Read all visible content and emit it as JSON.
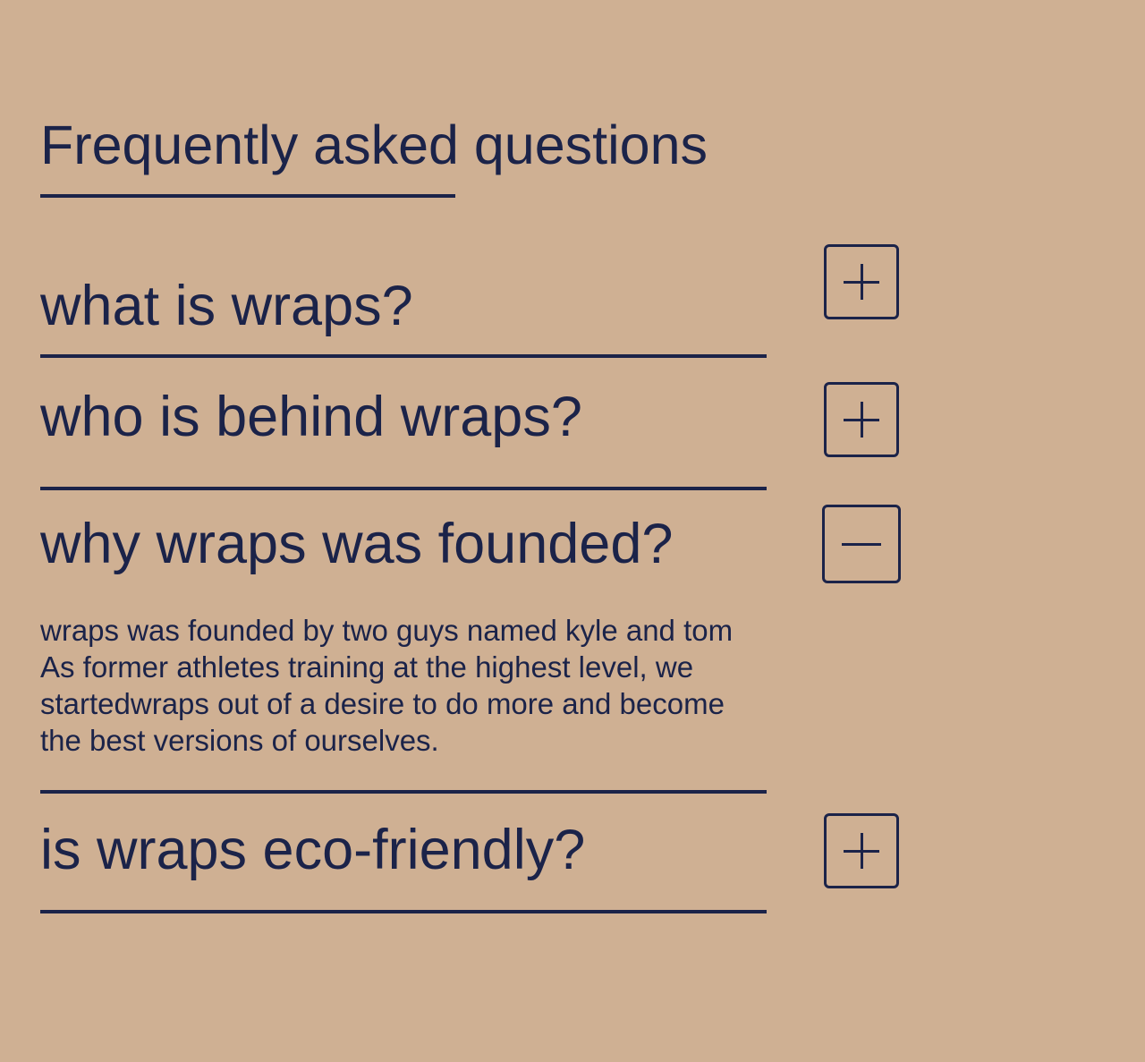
{
  "faq": {
    "title": "Frequently asked questions",
    "items": [
      {
        "question": "what is wraps?",
        "state": "collapsed",
        "toggle_icon": "plus-icon"
      },
      {
        "question": "who is behind wraps?",
        "state": "collapsed",
        "toggle_icon": "plus-icon"
      },
      {
        "question": "why wraps was founded?",
        "state": "expanded",
        "toggle_icon": "minus-icon",
        "answer_lines": [
          "wraps was founded by two guys named kyle and tom",
          "As former athletes training at the highest level, we",
          "startedwraps out of a desire to do more and become",
          "the best versions of ourselves."
        ]
      },
      {
        "question": "is wraps eco-friendly?",
        "state": "collapsed",
        "toggle_icon": "plus-icon"
      }
    ]
  },
  "colors": {
    "background": "#cfb093",
    "text": "#1b2349"
  }
}
